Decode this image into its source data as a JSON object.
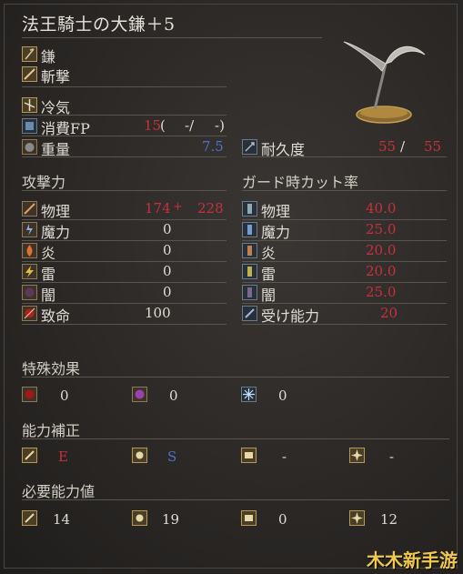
{
  "title": "法王騎士の大鎌＋5",
  "weapon_types": [
    "鎌",
    "斬撃"
  ],
  "attributes": {
    "frost_label": "冷気",
    "fp_label": "消費FP",
    "fp_value": "15",
    "fp_paren_open": "(",
    "fp_min": "-/",
    "fp_max": "-)",
    "weight_label": "重量",
    "weight_value": "7.5",
    "durability_label": "耐久度",
    "durability_current": "55",
    "durability_sep": "/",
    "durability_max": "55"
  },
  "attack": {
    "heading": "攻撃力",
    "rows": [
      {
        "label": "物理",
        "base": "174",
        "plus": "+",
        "bonus": "228",
        "icon": "sword-icon"
      },
      {
        "label": "魔力",
        "base": "0",
        "icon": "magic-icon"
      },
      {
        "label": "炎",
        "base": "0",
        "icon": "fire-icon"
      },
      {
        "label": "雷",
        "base": "0",
        "icon": "lightning-icon"
      },
      {
        "label": "闇",
        "base": "0",
        "icon": "dark-icon"
      },
      {
        "label": "致命",
        "base": "100",
        "icon": "critical-icon"
      }
    ]
  },
  "guard": {
    "heading": "ガード時カット率",
    "rows": [
      {
        "label": "物理",
        "value": "40.0"
      },
      {
        "label": "魔力",
        "value": "25.0"
      },
      {
        "label": "炎",
        "value": "20.0"
      },
      {
        "label": "雷",
        "value": "20.0"
      },
      {
        "label": "闇",
        "value": "25.0"
      },
      {
        "label": "受け能力",
        "value": "20"
      }
    ]
  },
  "special": {
    "heading": "特殊効果",
    "items": [
      {
        "value": "0",
        "icon": "bleed-icon"
      },
      {
        "value": "0",
        "icon": "poison-icon"
      },
      {
        "value": "0",
        "icon": "frost-icon"
      }
    ]
  },
  "scaling": {
    "heading": "能力補正",
    "items": [
      {
        "value": "E",
        "icon": "strength-icon"
      },
      {
        "value": "S",
        "icon": "dexterity-icon"
      },
      {
        "value": "-",
        "icon": "intelligence-icon"
      },
      {
        "value": "-",
        "icon": "faith-icon"
      }
    ]
  },
  "requirements": {
    "heading": "必要能力値",
    "items": [
      {
        "value": "14",
        "icon": "strength-icon"
      },
      {
        "value": "19",
        "icon": "dexterity-icon"
      },
      {
        "value": "0",
        "icon": "intelligence-icon"
      },
      {
        "value": "12",
        "icon": "faith-icon"
      }
    ]
  },
  "watermark": "木木新手游",
  "colors": {
    "red": "#c8313a",
    "blue": "#4a75c8",
    "text": "#e0dbd2"
  }
}
